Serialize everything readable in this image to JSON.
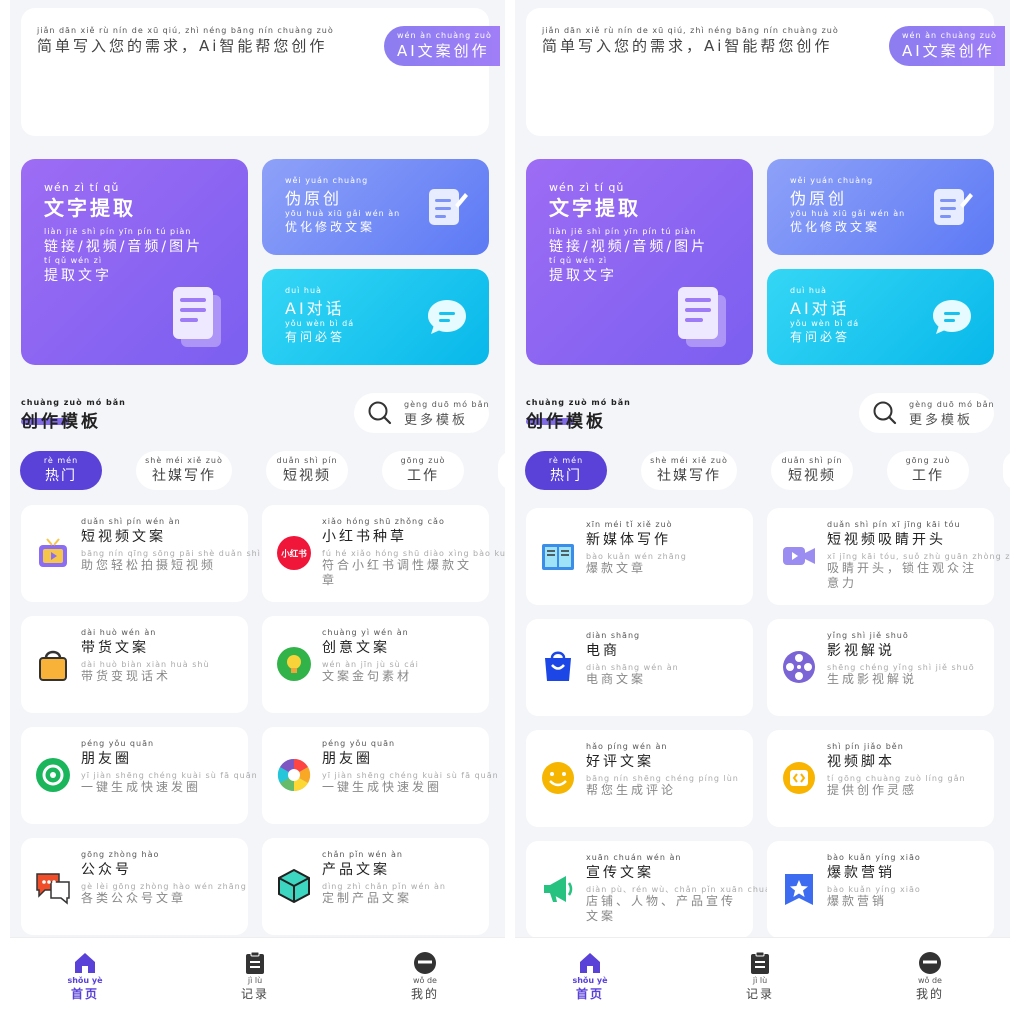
{
  "screens": [
    {
      "input": {
        "hint_py": "jiǎn dān xiě rù nín de xū qiú,  zhì néng bāng nín chuàng zuò",
        "hint": "简单写入您的需求，Ai智能帮您创作"
      },
      "ai_button": {
        "py": "wén àn chuàng zuò",
        "label": "AI文案创作"
      },
      "feature_main": {
        "title_py": "wén zì tí qǔ",
        "title": "文字提取",
        "desc_py": "liàn jiē shì pín yīn pín tú piàn",
        "desc": "链接/视频/音频/图片",
        "desc2_py": "tí qǔ wén zì",
        "desc2": "提取文字"
      },
      "feature_top": {
        "title_py": "wěi yuán chuàng",
        "title": "伪原创",
        "desc_py": "yōu huà xiū gǎi wén àn",
        "desc": "优化修改文案"
      },
      "feature_bottom": {
        "title_py": "duì huà",
        "title": "AI对话",
        "desc_py": "yǒu wèn bì dá",
        "desc": "有问必答"
      },
      "section": {
        "title_py": "chuàng zuò mó bǎn",
        "title": "创作模板"
      },
      "more": {
        "py": "gèng duō mó bǎn",
        "label": "更多模板"
      },
      "tabs": [
        {
          "py": "rè mén",
          "label": "热门"
        },
        {
          "py": "shè méi xiě zuò",
          "label": "社媒写作"
        },
        {
          "py": "duǎn shì pín",
          "label": "短视频"
        },
        {
          "py": "gōng zuò",
          "label": "工作"
        }
      ],
      "tiles": [
        {
          "title_py": "duǎn shì pín wén àn",
          "title": "短视频文案",
          "desc_py": "bāng nín qīng sōng pāi shè duǎn shì pín",
          "desc": "助您轻松拍摄短视频",
          "icon": "tv-icon"
        },
        {
          "title_py": "xiǎo hóng shū zhǒng cǎo",
          "title": "小红书种草",
          "desc_py": "fú hé xiǎo hóng shū diào xìng bào kuǎn wén zhāng",
          "desc": "符合小红书调性爆款文章",
          "icon": "xiaohongshu-icon",
          "icon_text": "小红书"
        },
        {
          "title_py": "dài huò wén àn",
          "title": "带货文案",
          "desc_py": "dài huò biàn xiàn huà shù",
          "desc": "带货变现话术",
          "icon": "shopping-bag-icon"
        },
        {
          "title_py": "chuàng yì wén àn",
          "title": "创意文案",
          "desc_py": "wén àn jīn jù sù cái",
          "desc": "文案金句素材",
          "icon": "lightbulb-icon"
        },
        {
          "title_py": "péng yǒu quān",
          "title": "朋友圈",
          "desc_py": "yī jiàn shēng chéng kuài sù fā quān",
          "desc": "一键生成快速发圈",
          "icon": "moments-icon"
        },
        {
          "title_py": "péng yǒu quān",
          "title": "朋友圈",
          "desc_py": "yī jiàn shēng chéng kuài sù fā quān",
          "desc": "一键生成快速发圈",
          "icon": "aperture-icon"
        },
        {
          "title_py": "gōng zhòng hào",
          "title": "公众号",
          "desc_py": "gè lèi gōng zhòng hào wén zhāng",
          "desc": "各类公众号文章",
          "icon": "chat-bubbles-icon"
        },
        {
          "title_py": "chǎn pǐn wén àn",
          "title": "产品文案",
          "desc_py": "dìng zhì chǎn pǐn wén àn",
          "desc": "定制产品文案",
          "icon": "box-icon"
        }
      ],
      "nav": [
        {
          "py": "shǒu yè",
          "label": "首页",
          "icon": "home-icon"
        },
        {
          "py": "jì lù",
          "label": "记录",
          "icon": "clipboard-icon"
        },
        {
          "py": "wǒ de",
          "label": "我的",
          "icon": "profile-icon"
        }
      ]
    },
    {
      "input": {
        "hint_py": "jiǎn dān xiě rù nín de xū qiú,  zhì néng bāng nín chuàng zuò",
        "hint": "简单写入您的需求，Ai智能帮您创作"
      },
      "ai_button": {
        "py": "wén àn chuàng zuò",
        "label": "AI文案创作"
      },
      "feature_main": {
        "title_py": "wén zì tí qǔ",
        "title": "文字提取",
        "desc_py": "liàn jiē shì pín yīn pín tú piàn",
        "desc": "链接/视频/音频/图片",
        "desc2_py": "tí qǔ wén zì",
        "desc2": "提取文字"
      },
      "feature_top": {
        "title_py": "wěi yuán chuàng",
        "title": "伪原创",
        "desc_py": "yōu huà xiū gǎi wén àn",
        "desc": "优化修改文案"
      },
      "feature_bottom": {
        "title_py": "duì huà",
        "title": "AI对话",
        "desc_py": "yǒu wèn bì dá",
        "desc": "有问必答"
      },
      "section": {
        "title_py": "chuàng zuò mó bǎn",
        "title": "创作模板"
      },
      "more": {
        "py": "gèng duō mó bǎn",
        "label": "更多模板"
      },
      "tabs": [
        {
          "py": "rè mén",
          "label": "热门"
        },
        {
          "py": "shè méi xiě zuò",
          "label": "社媒写作"
        },
        {
          "py": "duǎn shì pín",
          "label": "短视频"
        },
        {
          "py": "gōng zuò",
          "label": "工作"
        }
      ],
      "tiles": [
        {
          "title_py": "xīn méi tǐ xiě zuò",
          "title": "新媒体写作",
          "desc_py": "bào kuǎn wén zhāng",
          "desc": "爆款文章",
          "icon": "book-icon"
        },
        {
          "title_py": "duǎn shì pín xī jīng kāi tóu",
          "title": "短视频吸睛开头",
          "desc_py": "xī jīng kāi tóu, suǒ zhù guān zhòng zhù yì lì",
          "desc": "吸睛开头，锁住观众注意力",
          "icon": "video-camera-icon"
        },
        {
          "title_py": "diàn shāng",
          "title": "电商",
          "desc_py": "diàn shāng wén àn",
          "desc": "电商文案",
          "icon": "shopping-bag-icon"
        },
        {
          "title_py": "yǐng shì jiě shuō",
          "title": "影视解说",
          "desc_py": "shēng chéng yǐng shì jiě shuō",
          "desc": "生成影视解说",
          "icon": "film-reel-icon"
        },
        {
          "title_py": "hǎo píng wén àn",
          "title": "好评文案",
          "desc_py": "bāng nín shēng chéng píng lùn",
          "desc": "帮您生成评论",
          "icon": "smiley-icon"
        },
        {
          "title_py": "shì pín jiǎo běn",
          "title": "视频脚本",
          "desc_py": "tí gōng chuàng zuò líng gǎn",
          "desc": "提供创作灵感",
          "icon": "code-icon"
        },
        {
          "title_py": "xuān chuán wén àn",
          "title": "宣传文案",
          "desc_py": "diàn pù、rén wù、chǎn pǐn xuān chuán wén àn",
          "desc": "店铺、人物、产品宣传文案",
          "icon": "megaphone-icon"
        },
        {
          "title_py": "bào kuǎn yíng xiāo",
          "title": "爆款营销",
          "desc_py": "bào kuǎn yíng xiāo",
          "desc": "爆款营销",
          "icon": "star-badge-icon"
        }
      ],
      "nav": [
        {
          "py": "shǒu yè",
          "label": "首页",
          "icon": "home-icon"
        },
        {
          "py": "jì lù",
          "label": "记录",
          "icon": "clipboard-icon"
        },
        {
          "py": "wǒ de",
          "label": "我的",
          "icon": "profile-icon"
        }
      ]
    }
  ],
  "colors": {
    "accent": "#5a41d8",
    "purple_card": "#8b63f3",
    "blue_card": "#6d86f6",
    "cyan_card": "#14c3ef",
    "background": "#f4f5f9"
  }
}
